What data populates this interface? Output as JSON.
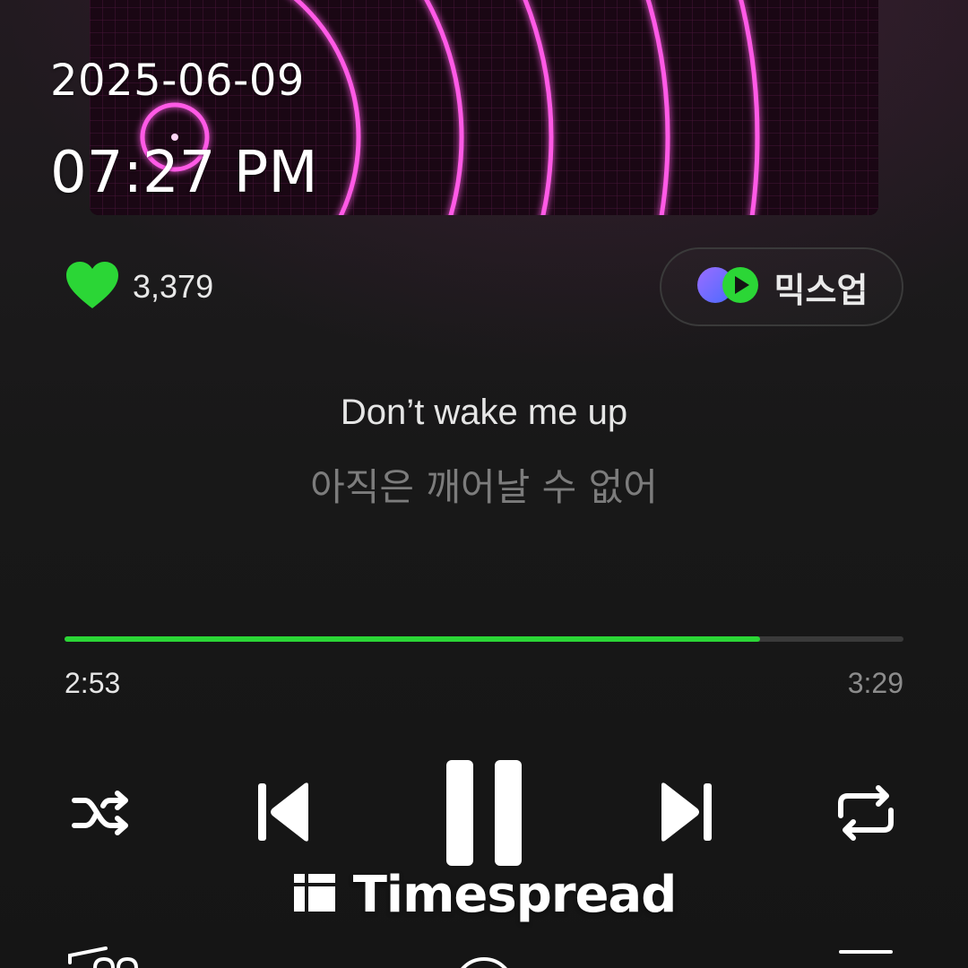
{
  "stamp": {
    "date": "2025-06-09",
    "time": "07:27 PM"
  },
  "like": {
    "icon": "heart-icon",
    "count": "3,379",
    "color": "#2bd636"
  },
  "mixup": {
    "icon": "mixup-logo-icon",
    "label": "믹스업"
  },
  "lyrics": {
    "current": "Don’t wake me up",
    "translation": "아직은 깨어날 수 없어"
  },
  "playback": {
    "elapsed": "2:53",
    "total": "3:29",
    "progress": 0.829,
    "accent": "#2bd636"
  },
  "controls": {
    "shuffle": "shuffle-icon",
    "previous": "skip-previous-icon",
    "play_pause": "pause-icon",
    "next": "skip-next-icon",
    "repeat": "repeat-icon"
  },
  "watermark": {
    "text": "Timespread"
  }
}
